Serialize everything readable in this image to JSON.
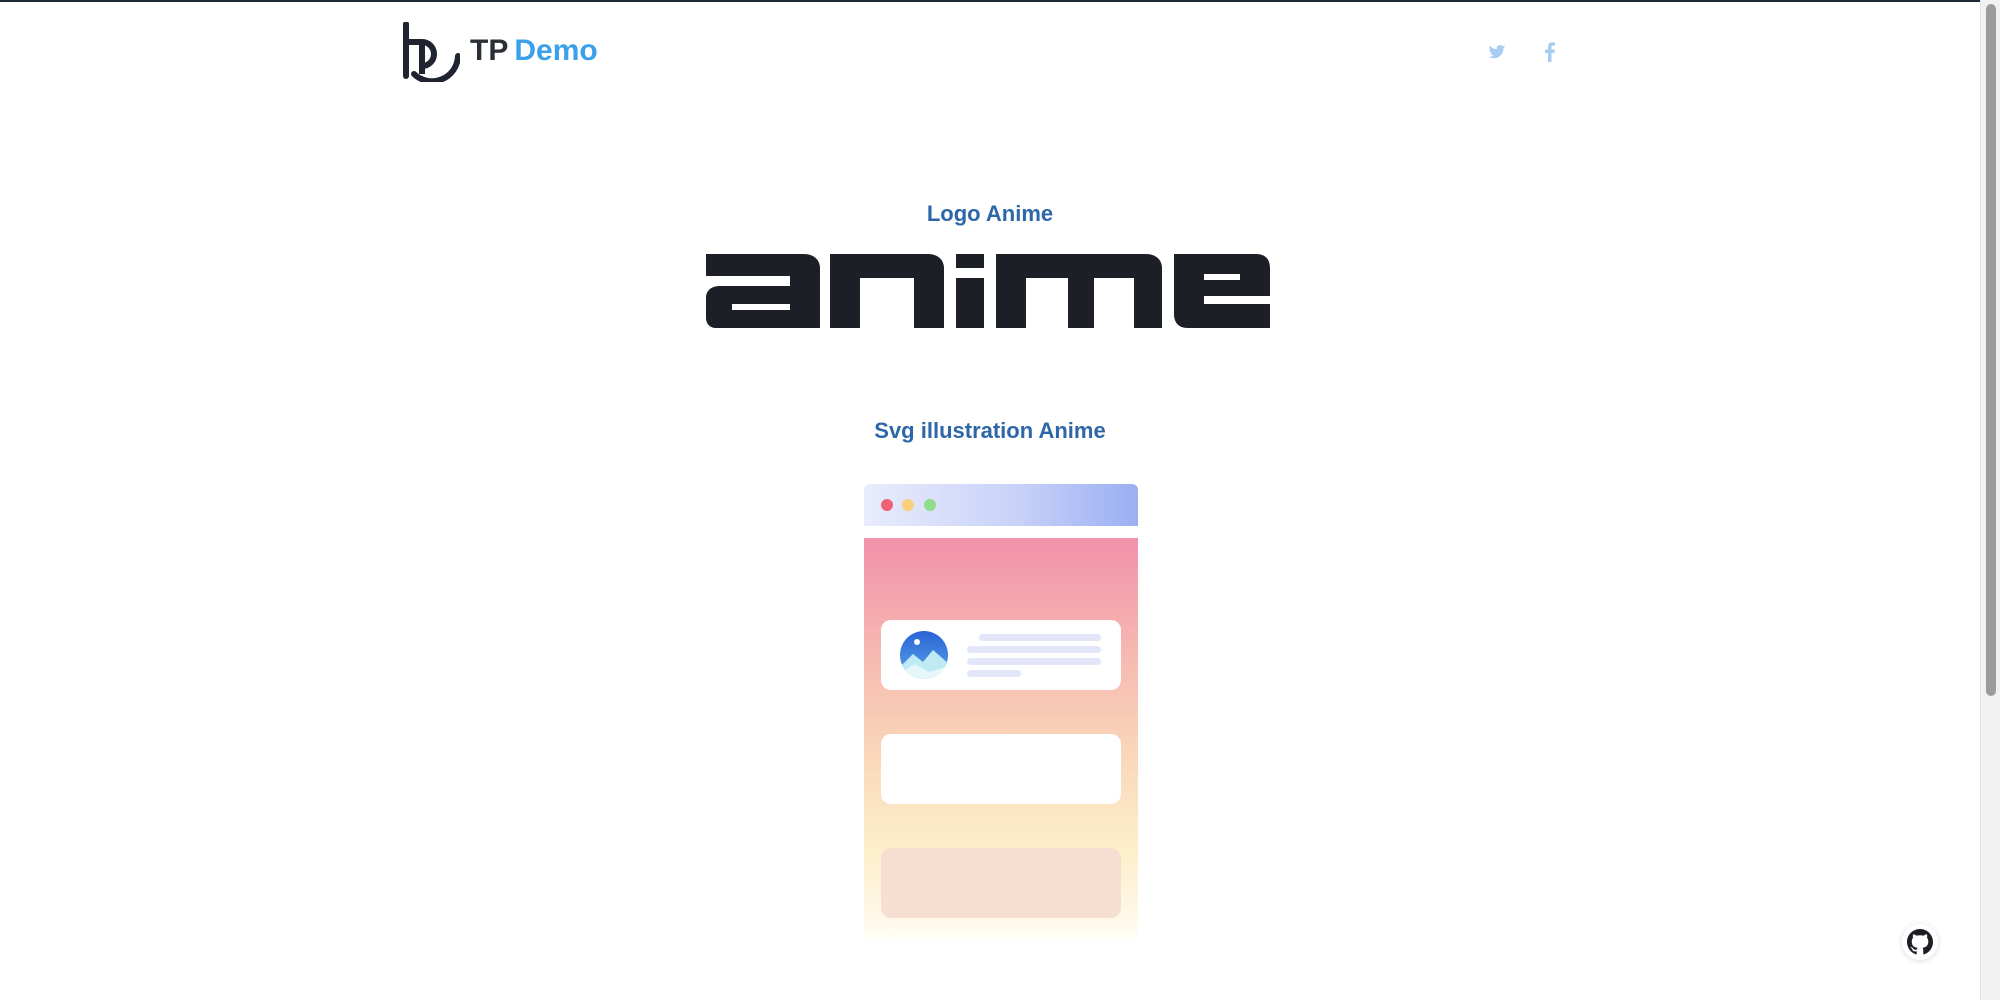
{
  "header": {
    "logo_icon": "tp-logo-icon",
    "brand_prefix": "TP",
    "brand_suffix": "Demo",
    "social": [
      {
        "icon": "twitter-icon"
      },
      {
        "icon": "facebook-icon"
      }
    ]
  },
  "sections": {
    "logo_title": "Logo Anime",
    "svg_title": "Svg illustration Anime"
  },
  "wordmark": {
    "text": "anime"
  },
  "floating": {
    "github_icon": "github-icon"
  },
  "colors": {
    "accent_blue": "#3aa0ea",
    "title_blue": "#2e67a8",
    "dark_text": "#2b2f36",
    "wordmark": "#1c1f26"
  }
}
